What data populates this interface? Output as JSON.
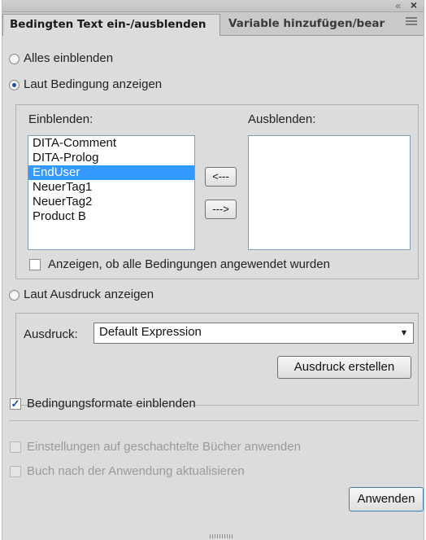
{
  "panel": {
    "collapse_icon": "double-chevron-right-icon",
    "close_icon": "close-icon",
    "menu_icon": "panel-menu-icon"
  },
  "tabs": [
    {
      "label": "Bedingten Text ein-/ausblenden"
    },
    {
      "label": "Variable hinzufügen/bear"
    }
  ],
  "options": {
    "show_all": "Alles einblenden",
    "by_condition": "Laut Bedingung anzeigen",
    "by_expression": "Laut Ausdruck anzeigen"
  },
  "condition": {
    "show_label": "Einblenden:",
    "hide_label": "Ausblenden:",
    "show_items": [
      "DITA-Comment",
      "DITA-Prolog",
      "EndUser",
      "NeuerTag1",
      "NeuerTag2",
      "Product B"
    ],
    "selected_item": "EndUser",
    "hide_items": [],
    "move_left": "<---",
    "move_right": "--->",
    "show_applied_checkbox": "Anzeigen, ob alle Bedingungen angewendet wurden"
  },
  "expression": {
    "label": "Ausdruck:",
    "value": "Default Expression",
    "create_button": "Ausdruck erstellen"
  },
  "show_formats": "Bedingungsformate einblenden",
  "apply_nested": "Einstellungen auf geschachtelte Bücher anwenden",
  "update_book": "Buch nach der Anwendung aktualisieren",
  "apply_button": "Anwenden",
  "colors": {
    "panel_bg": "#dcdcdc",
    "selection": "#3399ff",
    "accent": "#1f4f9e"
  }
}
